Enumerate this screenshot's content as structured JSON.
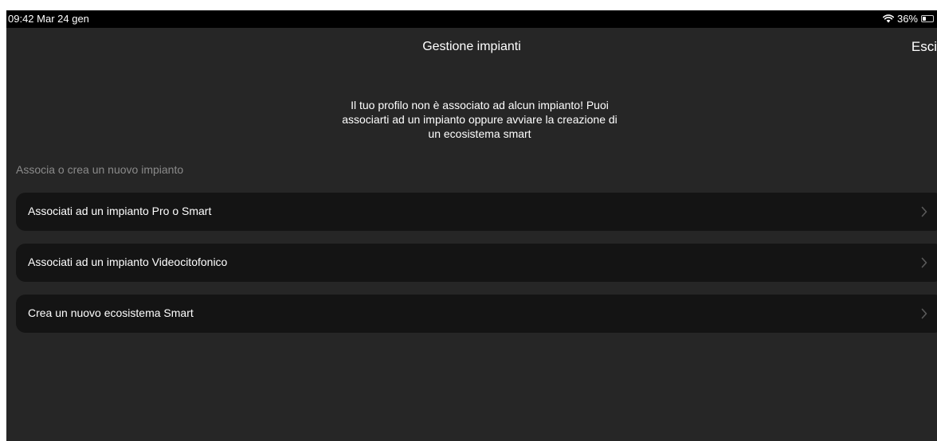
{
  "status_bar": {
    "time_date": "09:42  Mar 24 gen",
    "battery_percent": "36%",
    "battery_level": 0.36,
    "icons": [
      "wifi-icon",
      "battery-icon"
    ]
  },
  "nav": {
    "title": "Gestione impianti",
    "exit_label": "Esci"
  },
  "message": {
    "line1": "Il tuo profilo non è associato ad alcun impianto! Puoi",
    "line2": "associarti ad un impianto oppure avviare la creazione di",
    "line3": "un ecosistema smart"
  },
  "section": {
    "header": "Associa o crea un nuovo impianto",
    "items": [
      {
        "label": "Associati ad un impianto Pro o Smart",
        "icon": "chevron-right-icon"
      },
      {
        "label": "Associati ad un impianto Videocitofonico",
        "icon": "chevron-right-icon"
      },
      {
        "label": "Crea un nuovo ecosistema Smart",
        "icon": "chevron-right-icon"
      }
    ]
  },
  "colors": {
    "background": "#262626",
    "row_background": "#141414",
    "section_header": "#8a8a8a",
    "text": "#ffffff"
  }
}
